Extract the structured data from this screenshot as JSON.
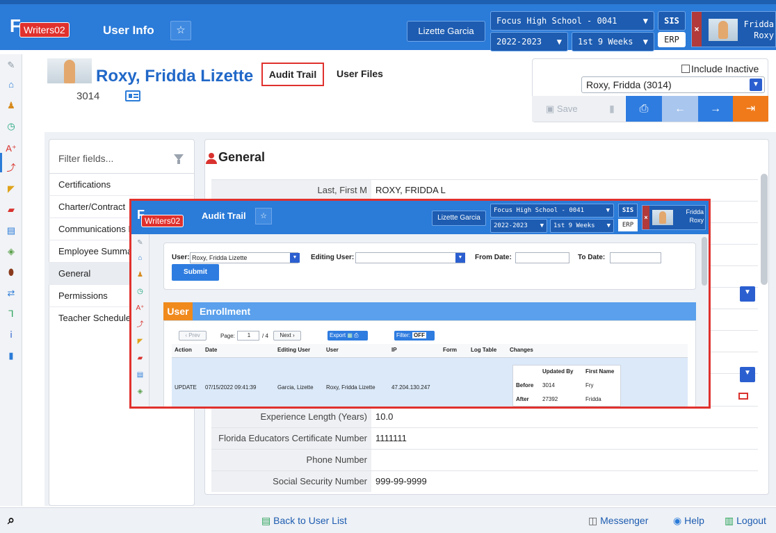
{
  "header": {
    "logo_text": "Writers02",
    "page_title": "User Info",
    "current_user_button": "Lizette Garcia",
    "school_select": "Focus High School - 0041",
    "year_select": "2022-2023",
    "period_select": "1st 9 Weeks",
    "sis_label": "SIS",
    "erp_label": "ERP",
    "profile_first": "Fridda",
    "profile_last": "Roxy"
  },
  "profile": {
    "name": "Roxy, Fridda Lizette",
    "id": "3014",
    "tabs": [
      "Audit Trail",
      "User Files"
    ]
  },
  "controls": {
    "include_inactive": "Include Inactive",
    "user_select": "Roxy, Fridda (3014)",
    "save_label": "Save"
  },
  "sidebar": {
    "filter_placeholder": "Filter fields...",
    "items": [
      "Certifications",
      "Charter/Contract",
      "Communications I",
      "Employee Summa",
      "General",
      "Permissions",
      "Teacher Schedule"
    ],
    "active": "General"
  },
  "general": {
    "title": "General",
    "fields": [
      {
        "label": "Last, First M",
        "value": "ROXY, FRIDDA L"
      },
      {
        "label": "Experience Length (Years)",
        "value": "10.0"
      },
      {
        "label": "Florida Educators Certificate Number",
        "value": "1111111"
      },
      {
        "label": "Phone Number",
        "value": ""
      },
      {
        "label": "Social Security Number",
        "value": "999-99-9999"
      }
    ]
  },
  "footer": {
    "back_label": "Back to User List",
    "messenger_label": "Messenger",
    "help_label": "Help",
    "logout_label": "Logout"
  },
  "overlay": {
    "logo_text": "Writers02",
    "title": "Audit Trail",
    "current_user_button": "Lizette Garcia",
    "school_select": "Focus High School - 0041",
    "year_select": "2022-2023",
    "period_select": "1st 9 Weeks",
    "sis_label": "SIS",
    "erp_label": "ERP",
    "profile_first": "Fridda",
    "profile_last": "Roxy",
    "form": {
      "user_label": "User:",
      "user_value": "Roxy, Fridda Lizette",
      "editing_user_label": "Editing User:",
      "from_date_label": "From Date:",
      "to_date_label": "To Date:",
      "submit_label": "Submit"
    },
    "tabs": {
      "user": "User",
      "enrollment": "Enrollment"
    },
    "pager": {
      "prev": "‹ Prev",
      "page_label": "Page:",
      "page": "1",
      "total": "/ 4",
      "next": "Next ›",
      "export": "Export",
      "filter_label": "Filter:",
      "filter_state": "OFF"
    },
    "columns": [
      "Action",
      "Date",
      "Editing User",
      "User",
      "IP",
      "Form",
      "Log Table",
      "Changes"
    ],
    "row": {
      "action": "UPDATE",
      "date": "07/15/2022 09:41:39",
      "editing_user": "Garcia, Lizette",
      "user": "Roxy, Fridda Lizette",
      "ip": "47.204.130.247"
    },
    "changes": {
      "col1": "Updated By",
      "col2": "First Name",
      "before_label": "Before",
      "before_by": "3014",
      "before_name": "Fry",
      "after_label": "After",
      "after_by": "27392",
      "after_name": "Fridda"
    }
  }
}
